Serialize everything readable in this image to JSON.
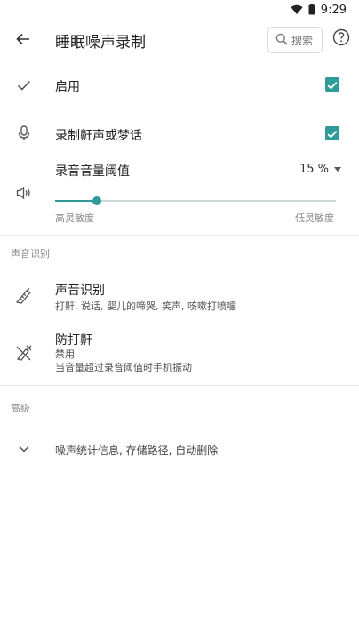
{
  "status_bar": {
    "time": "9:29"
  },
  "app_bar": {
    "title": "睡眠噪声录制",
    "search_label": "搜索"
  },
  "settings": {
    "enable": {
      "label": "启用",
      "checked": true
    },
    "record_snore": {
      "label": "录制鼾声或梦话",
      "checked": true
    },
    "threshold": {
      "label": "录音音量阈值",
      "value_text": "15 %",
      "value_fraction": 0.15,
      "min_label": "高灵敏度",
      "max_label": "低灵敏度"
    }
  },
  "sections": {
    "sound_recognition": {
      "header": "声音识别",
      "item": {
        "title": "声音识别",
        "subtitle": "打鼾, 说话, 婴儿的啼哭, 笑声, 咳嗽打喷嚏"
      },
      "anti_snore": {
        "title": "防打鼾",
        "status": "禁用",
        "description": "当音量超过录音阈值时手机振动"
      }
    },
    "advanced": {
      "header": "高级",
      "item": {
        "label": "噪声统计信息, 存储路径, 自动删除"
      }
    }
  },
  "colors": {
    "accent": "#2f9c9a",
    "text": "#222222",
    "muted": "#888888",
    "divider": "#e6e6e6"
  }
}
